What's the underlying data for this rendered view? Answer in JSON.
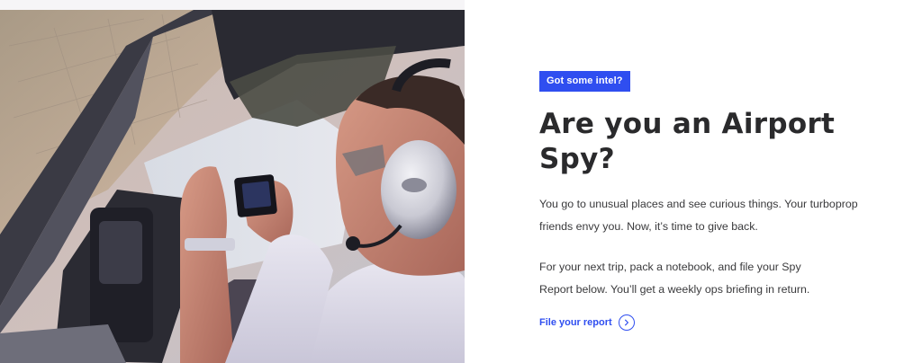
{
  "hero": {
    "badge": "Got some intel?",
    "title": "Are you an Airport Spy?",
    "paragraph_1": "You go to unusual places and see curious things. Your turboprop friends envy you. Now, it’s time to give back.",
    "paragraph_2": "For your next trip, pack a notebook, and file your Spy Report below. You’ll get a weekly ops briefing in return.",
    "cta_label": "File your report",
    "cta_icon": "chevron-right-icon"
  },
  "colors": {
    "accent": "#2f4ef0",
    "heading": "#2a2a2c",
    "body_text": "#3a3a3c",
    "background": "#ffffff"
  },
  "image": {
    "subject": "pilot-photographing-from-cockpit"
  }
}
